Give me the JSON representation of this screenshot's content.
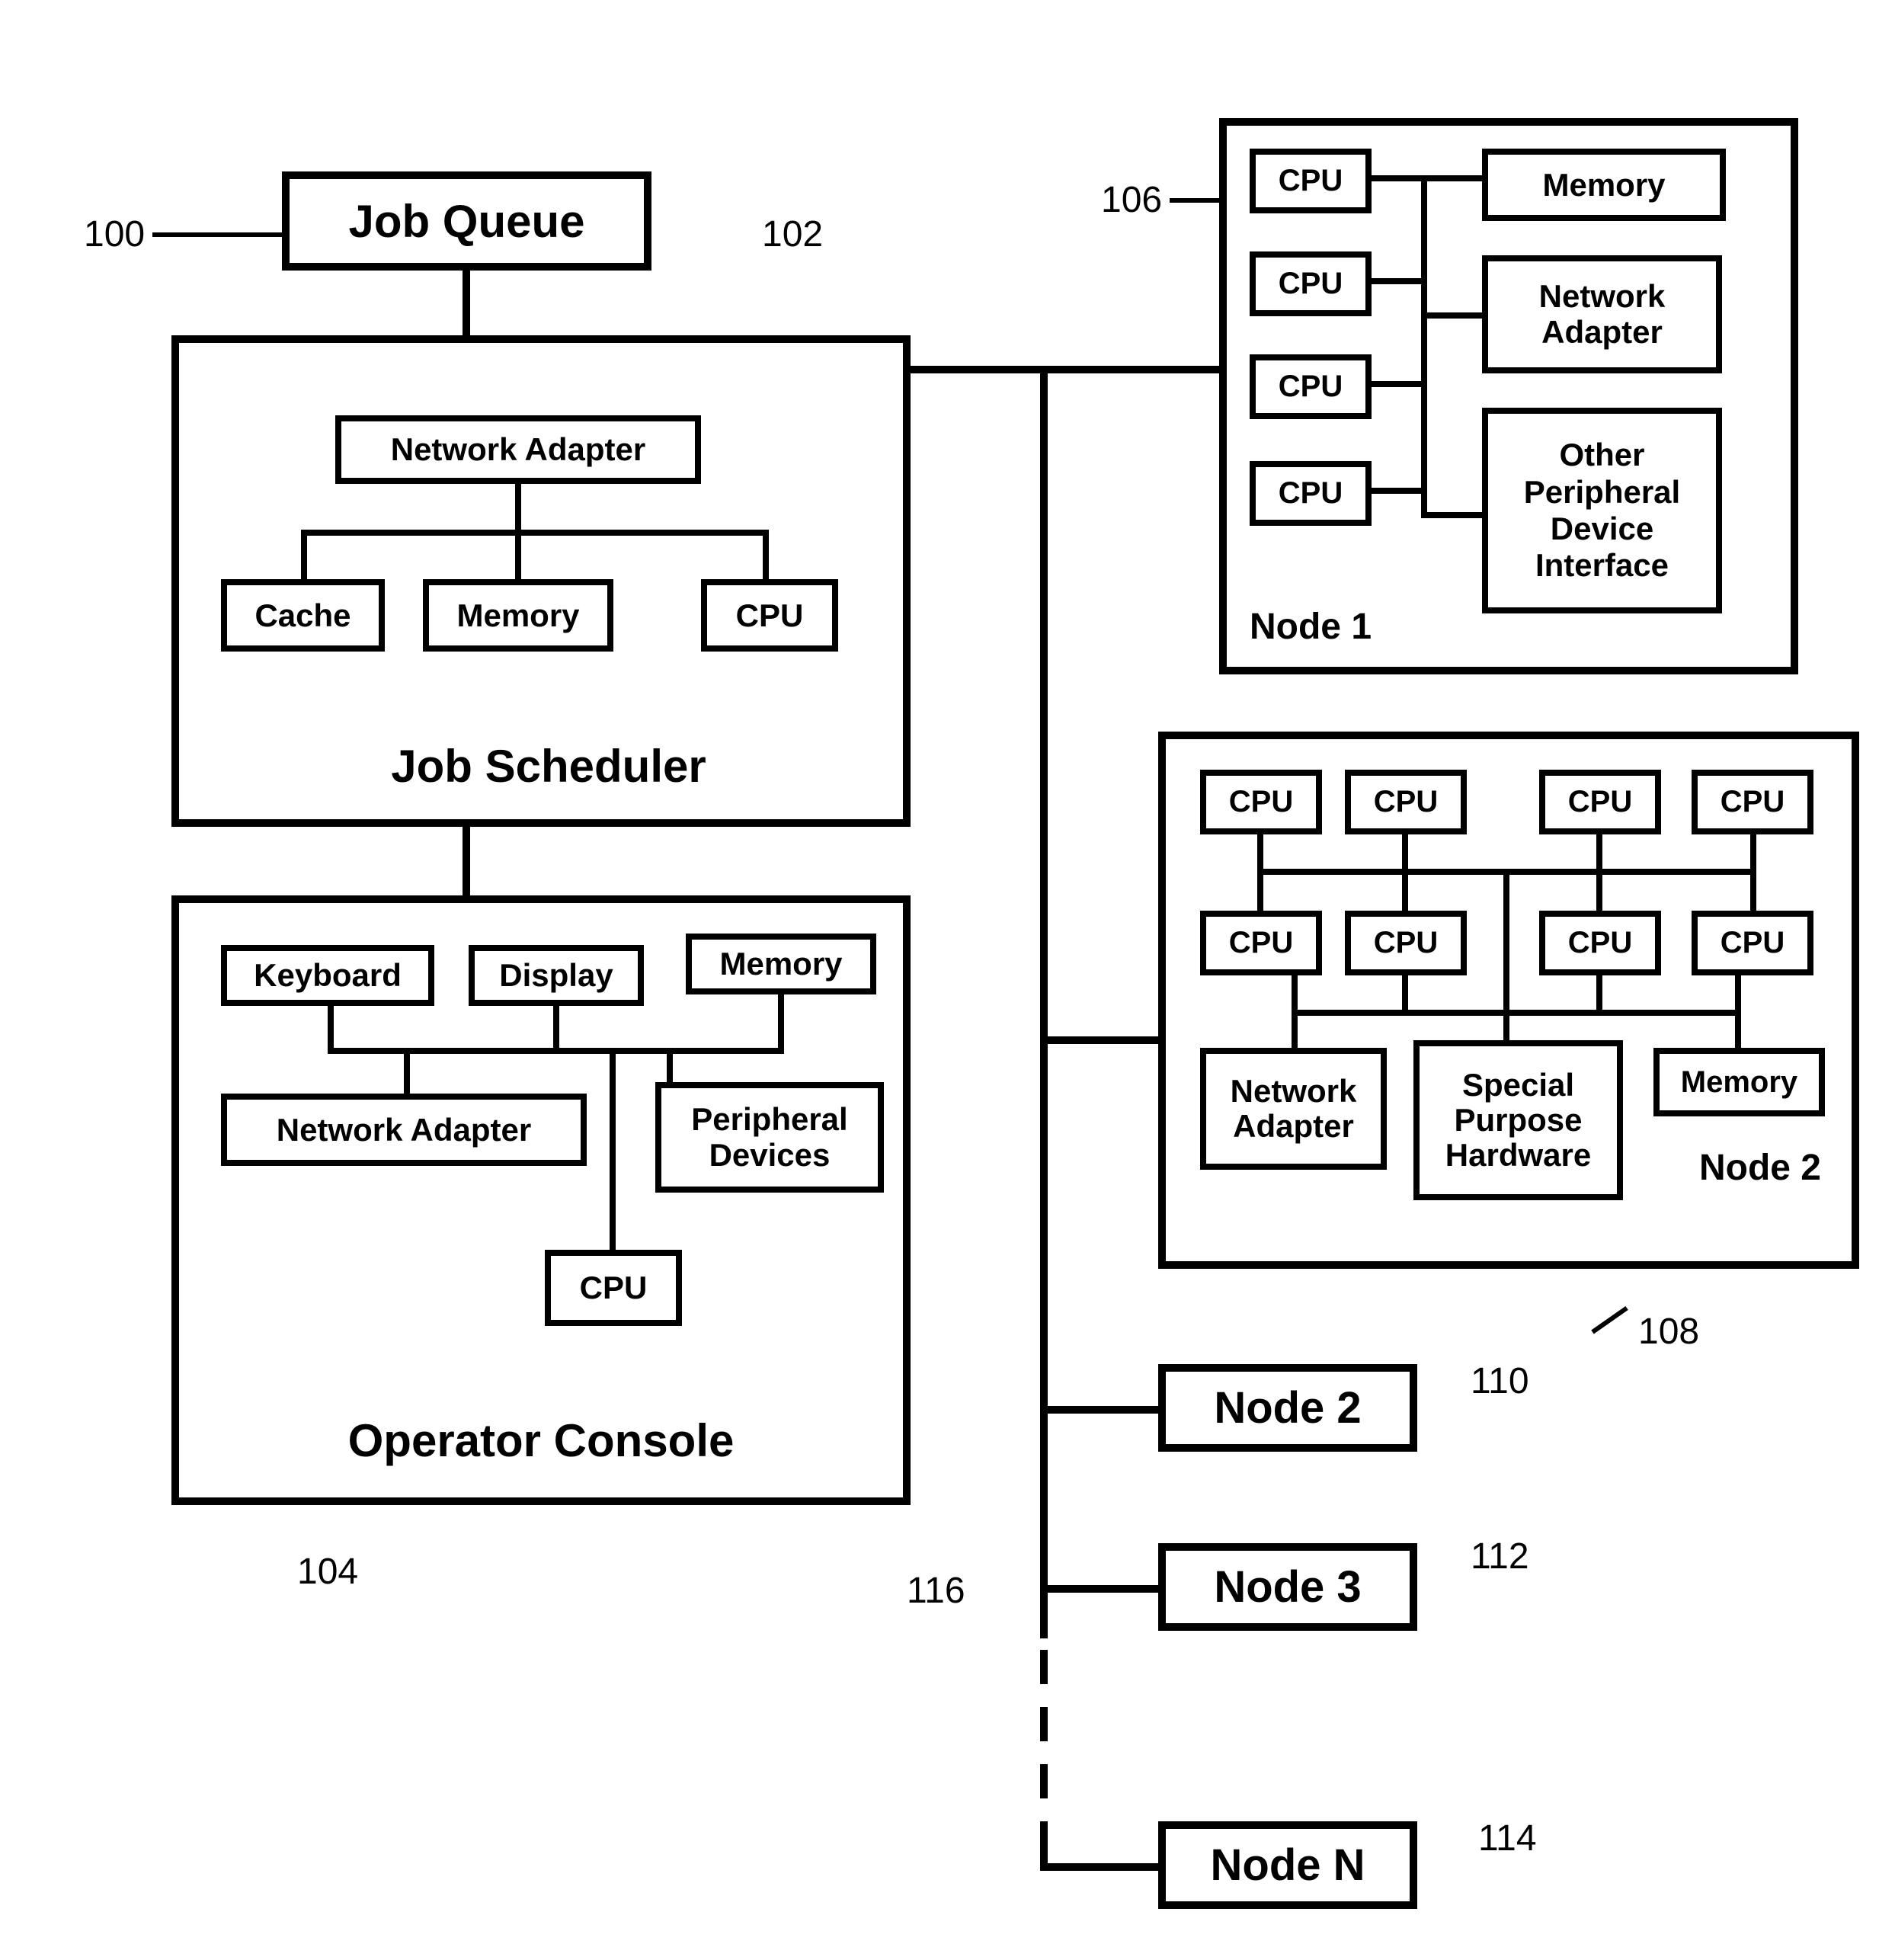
{
  "refs": {
    "r100": "100",
    "r102": "102",
    "r104": "104",
    "r106": "106",
    "r108": "108",
    "r110": "110",
    "r112": "112",
    "r114": "114",
    "r116": "116"
  },
  "jobQueue": {
    "title": "Job Queue"
  },
  "jobScheduler": {
    "title": "Job Scheduler",
    "networkAdapter": "Network Adapter",
    "cache": "Cache",
    "memory": "Memory",
    "cpu": "CPU"
  },
  "operatorConsole": {
    "title": "Operator Console",
    "keyboard": "Keyboard",
    "display": "Display",
    "memory": "Memory",
    "networkAdapter": "Network Adapter",
    "peripheral": "Peripheral Devices",
    "cpu": "CPU"
  },
  "node1": {
    "title": "Node 1",
    "cpu": "CPU",
    "memory": "Memory",
    "networkAdapter": "Network Adapter",
    "other": "Other Peripheral Device Interface"
  },
  "node2big": {
    "title": "Node 2",
    "cpu": "CPU",
    "networkAdapter": "Network Adapter",
    "special": "Special Purpose Hardware",
    "memory": "Memory"
  },
  "node2small": {
    "title": "Node 2"
  },
  "node3": {
    "title": "Node 3"
  },
  "nodeN": {
    "title": "Node N"
  }
}
